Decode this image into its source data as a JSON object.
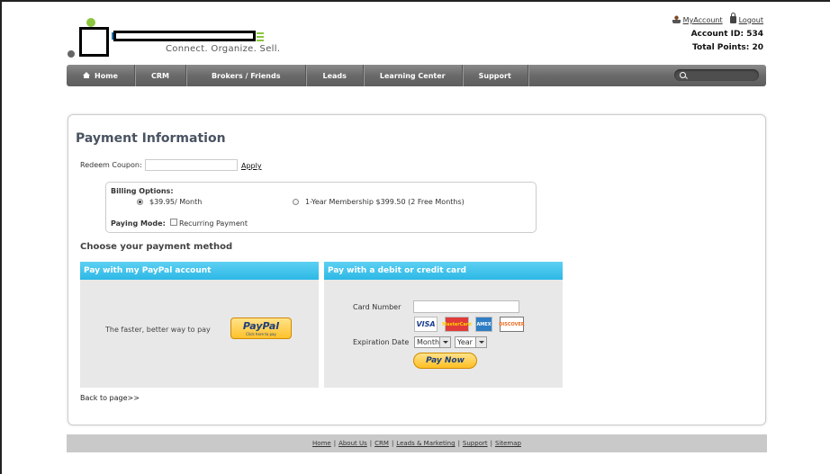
{
  "header": {
    "tagline": "Connect. Organize. Sell.",
    "my_account": "MyAccount",
    "logout": "Logout",
    "account_id": "Account ID: 534",
    "total_points": "Total Points: 20"
  },
  "nav": {
    "items": [
      "Home",
      "CRM",
      "Brokers / Friends",
      "Leads",
      "Learning Center",
      "Support"
    ],
    "search_value": ""
  },
  "page": {
    "title": "Payment Information",
    "coupon_label": "Redeem Coupon:",
    "coupon_value": "",
    "apply": "Apply",
    "billing_label": "Billing Options:",
    "option_monthly": "$39.95/ Month",
    "option_yearly": "1-Year Membership $399.50 (2 Free Months)",
    "paying_mode_label": "Paying Mode:",
    "recurring_label": "Recurring Payment",
    "choose_title": "Choose your payment method",
    "back_link": "Back to page>>"
  },
  "paypal": {
    "header": "Pay with my PayPal account",
    "text": "The faster, better way to pay",
    "button_word": "PayPal",
    "button_sub": "Click here to pay"
  },
  "card": {
    "header": "Pay with a debit or credit card",
    "card_label": "Card Number",
    "card_value": "",
    "logos": [
      "VISA",
      "MasterCard",
      "AMEX",
      "DISCOVER"
    ],
    "exp_label": "Expiration Date",
    "month_value": "Month",
    "year_value": "Year",
    "pay_now": "Pay Now"
  },
  "footer": {
    "links": [
      "Home",
      "About Us",
      "CRM",
      "Leads & Marketing",
      "Support",
      "Sitemap"
    ],
    "separator": "|"
  },
  "colors": {
    "nav_bg": "#6a6a6a",
    "section_header": "#2cb8e6",
    "title": "#4a5362",
    "button_gold": "#ffc22b"
  }
}
